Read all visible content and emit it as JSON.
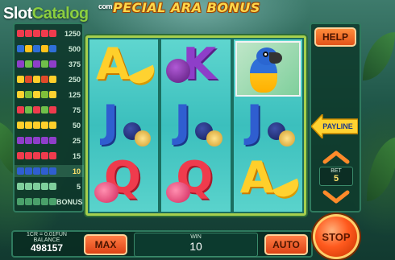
{
  "brand": {
    "part1": "Slot",
    "part2": "Catalog",
    "suffix": "com"
  },
  "title": "PECIAL ARA BONUS",
  "paytable": [
    {
      "value": "1250",
      "colors": [
        "#ef3b4d",
        "#ef3b4d",
        "#ef3b4d",
        "#ef3b4d",
        "#ef3b4d"
      ]
    },
    {
      "value": "500",
      "colors": [
        "#2f6fd8",
        "#ffc21a",
        "#2f6fd8",
        "#ffc21a",
        "#2f6fd8"
      ]
    },
    {
      "value": "375",
      "colors": [
        "#8e3ec9",
        "#6fbf4a",
        "#8e3ec9",
        "#6fbf4a",
        "#8e3ec9"
      ]
    },
    {
      "value": "250",
      "colors": [
        "#ffcf2b",
        "#e04a2a",
        "#ffcf2b",
        "#e04a2a",
        "#ffcf2b"
      ]
    },
    {
      "value": "125",
      "colors": [
        "#ffd230",
        "#7fbf3a",
        "#ffd230",
        "#7fbf3a",
        "#ffd230"
      ]
    },
    {
      "value": "75",
      "colors": [
        "#ef3b4d",
        "#6fbf4a",
        "#ef3b4d",
        "#6fbf4a",
        "#ef3b4d"
      ]
    },
    {
      "value": "50",
      "colors": [
        "#ffcf2b",
        "#ffcf2b",
        "#ffcf2b",
        "#ffcf2b",
        "#ffcf2b"
      ]
    },
    {
      "value": "25",
      "colors": [
        "#8e3ec9",
        "#8e3ec9",
        "#8e3ec9",
        "#8e3ec9",
        "#8e3ec9"
      ]
    },
    {
      "value": "15",
      "colors": [
        "#ef3b4d",
        "#ef3b4d",
        "#ef3b4d",
        "#ef3b4d",
        "#ef3b4d"
      ]
    },
    {
      "value": "10",
      "colors": [
        "#2f5ed0",
        "#2f5ed0",
        "#2f5ed0",
        "#2f5ed0",
        "#2f5ed0"
      ],
      "highlight": true
    },
    {
      "value": "5",
      "colors": [
        "#7fcf9c",
        "#7fcf9c",
        "#7fcf9c",
        "#7fcf9c",
        "#7fcf9c"
      ]
    },
    {
      "value": "BONUS",
      "colors": [
        "#4aa06a",
        "#4aa06a",
        "#4aa06a",
        "#4aa06a",
        "#4aa06a"
      ]
    }
  ],
  "reels": [
    [
      "A",
      "J",
      "Q"
    ],
    [
      "K",
      "J",
      "Q"
    ],
    [
      "parrot",
      "J",
      "A"
    ]
  ],
  "controls": {
    "help": "HELP",
    "payline": "PAYLINE",
    "bet_label": "BET",
    "bet_value": "5",
    "max": "MAX",
    "auto": "AUTO",
    "stop": "STOP"
  },
  "balance": {
    "denomination": "1CR = 0.01FUN",
    "label": "BALANCE",
    "value": "498157"
  },
  "win": {
    "label": "WIN",
    "value": "10"
  },
  "icons": {
    "bet_up": "chevron-up-icon",
    "bet_down": "chevron-down-icon",
    "payline": "arrow-left-icon"
  }
}
